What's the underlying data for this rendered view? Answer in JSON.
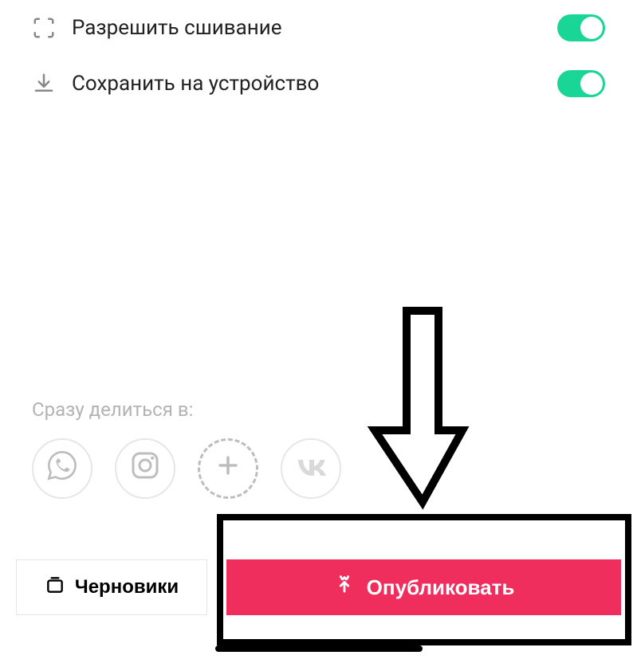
{
  "settings": {
    "stitch": {
      "label": "Разрешить сшивание",
      "icon": "stitch-icon",
      "on": true
    },
    "save": {
      "label": "Сохранить на устройство",
      "icon": "download-icon",
      "on": true
    }
  },
  "share": {
    "label": "Сразу делиться в:",
    "options": [
      {
        "name": "whatsapp"
      },
      {
        "name": "instagram"
      },
      {
        "name": "add-more"
      },
      {
        "name": "vk"
      }
    ]
  },
  "buttons": {
    "drafts": "Черновики",
    "publish": "Опубликовать"
  },
  "colors": {
    "accent_green": "#1ad696",
    "accent_red": "#ef2e5e"
  }
}
